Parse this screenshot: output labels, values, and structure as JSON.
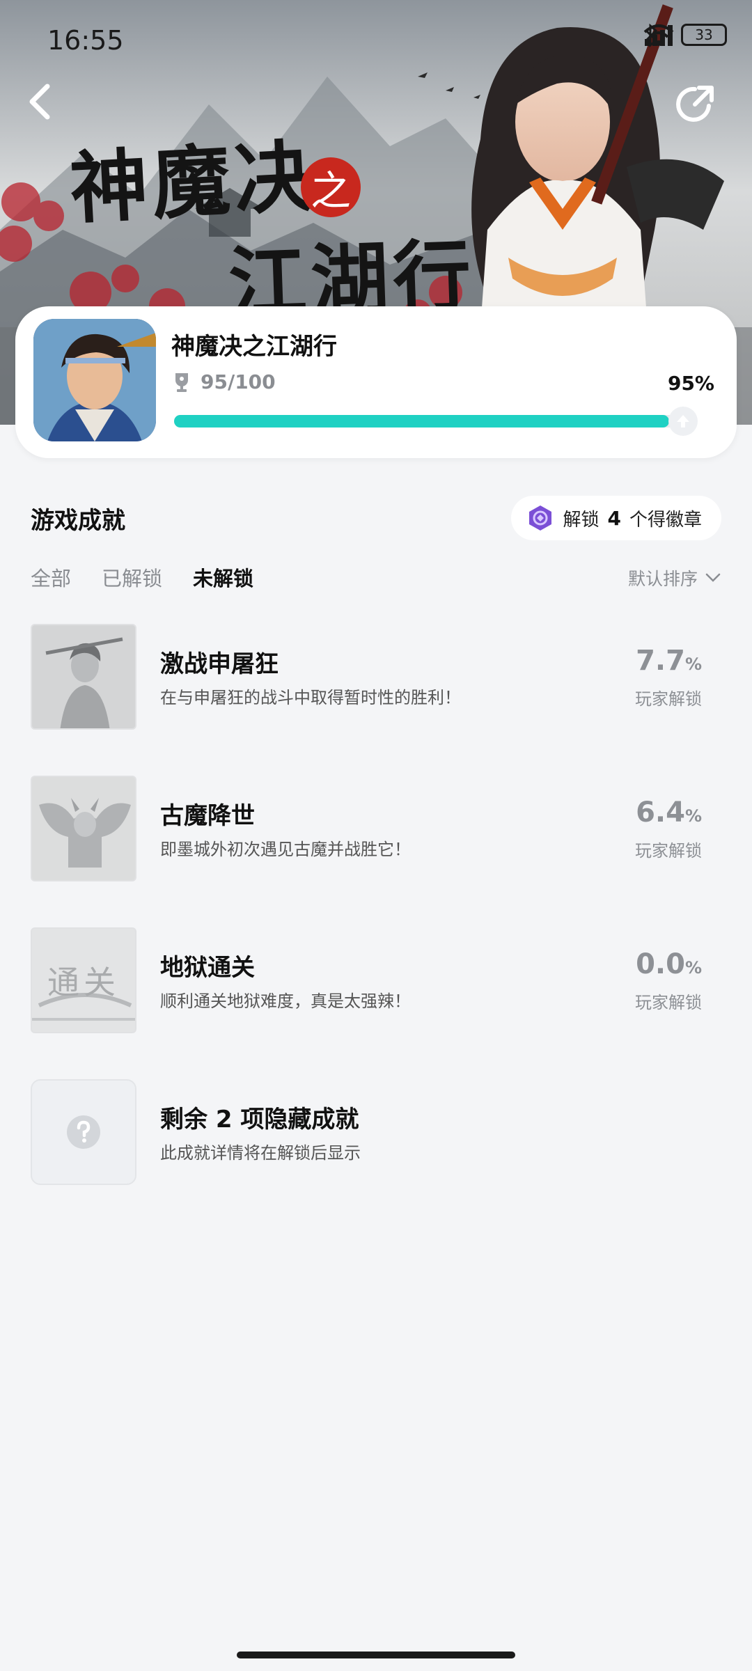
{
  "status_bar": {
    "time": "16:55",
    "battery": "33"
  },
  "banner": {
    "title_line1": "神魔决",
    "seal": "之",
    "title_line2": "江湖行"
  },
  "game": {
    "name": "神魔决之江湖行",
    "trophy_count": "95/100",
    "progress_percent_text": "95%",
    "progress_fraction": 0.95
  },
  "section": {
    "title": "游戏成就",
    "badge_hint": {
      "prefix": "解锁",
      "count": "4",
      "suffix": "个得徽章"
    },
    "tabs": [
      {
        "label": "全部"
      },
      {
        "label": "已解锁"
      },
      {
        "label": "未解锁"
      }
    ],
    "active_tab": "未解锁",
    "sort_label": "默认排序"
  },
  "achievements": [
    {
      "title": "激战申屠狂",
      "desc": "在与申屠狂的战斗中取得暂时性的胜利！",
      "pct": "7.7",
      "pct_unit": "%",
      "pct_label": "玩家解锁"
    },
    {
      "title": "古魔降世",
      "desc": "即墨城外初次遇见古魔并战胜它！",
      "pct": "6.4",
      "pct_unit": "%",
      "pct_label": "玩家解锁"
    },
    {
      "title": "地狱通关",
      "desc": "顺利通关地狱难度，真是太强辣！",
      "pct": "0.0",
      "pct_unit": "%",
      "pct_label": "玩家解锁",
      "thumb_text": "通关"
    }
  ],
  "hidden": {
    "title": "剩余 2 项隐藏成就",
    "desc": "此成就详情将在解锁后显示",
    "icon": "question-icon"
  },
  "colors": {
    "accent": "#1fd1c3",
    "badge": "#7b4fd6",
    "seal": "#c8281e"
  }
}
